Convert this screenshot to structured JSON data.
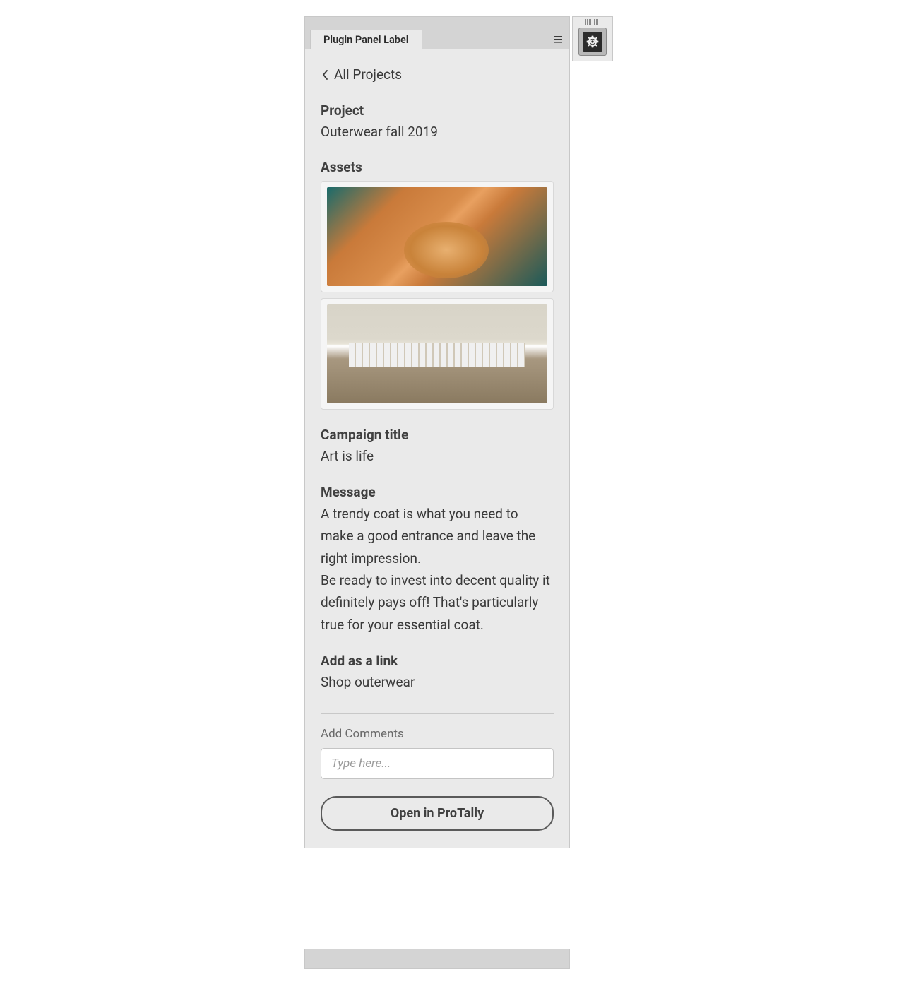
{
  "header": {
    "tab_label": "Plugin Panel Label"
  },
  "back": {
    "label": "All Projects"
  },
  "project": {
    "label": "Project",
    "value": "Outerwear fall 2019"
  },
  "assets": {
    "label": "Assets"
  },
  "campaign": {
    "label": "Campaign title",
    "value": "Art is life"
  },
  "message": {
    "label": "Message",
    "para1": "A trendy coat is what you need to make a good entrance and leave the right impression.",
    "para2": "Be ready to invest into decent quality it definitely pays off! That's particularly true for your essential coat."
  },
  "link": {
    "label": "Add as a link",
    "value": "Shop outerwear"
  },
  "comments": {
    "label": "Add Comments",
    "placeholder": "Type here..."
  },
  "cta": {
    "label": "Open in ProTally"
  }
}
